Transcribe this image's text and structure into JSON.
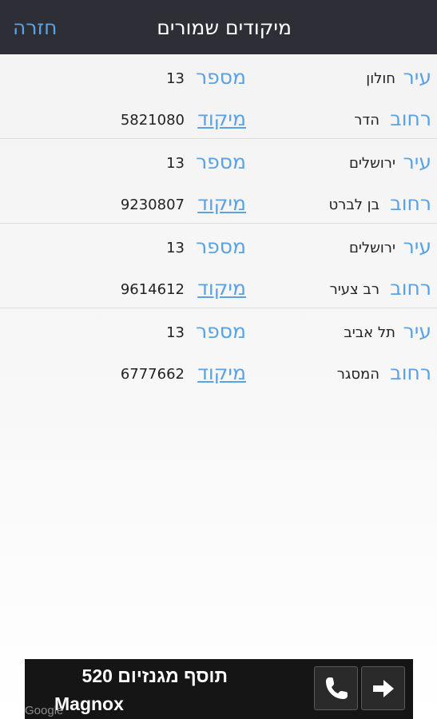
{
  "header": {
    "title": "מיקודים שמורים",
    "back_label": "חזרה"
  },
  "labels": {
    "city": "עיר",
    "street": "רחוב",
    "number": "מספר",
    "zip": "מיקוד"
  },
  "entries": [
    {
      "city": "חולון",
      "street": "הדר",
      "number": "13",
      "zip": "5821080"
    },
    {
      "city": "ירושלים",
      "street": "בן לברט",
      "number": "13",
      "zip": "9230807"
    },
    {
      "city": "ירושלים",
      "street": "רב צעיר",
      "number": "13",
      "zip": "9614612"
    },
    {
      "city": "תל אביב",
      "street": "המסגר",
      "number": "13",
      "zip": "6777662"
    }
  ],
  "ad": {
    "line1": "תוסף מגנזיום 520",
    "line2": "Magnox",
    "watermark": "Google"
  },
  "icons": {
    "call": "phone-icon",
    "go": "arrow-right-icon"
  },
  "colors": {
    "header_bg": "#2e2f36",
    "accent": "#5aa2e6",
    "ad_bg": "#151515"
  }
}
